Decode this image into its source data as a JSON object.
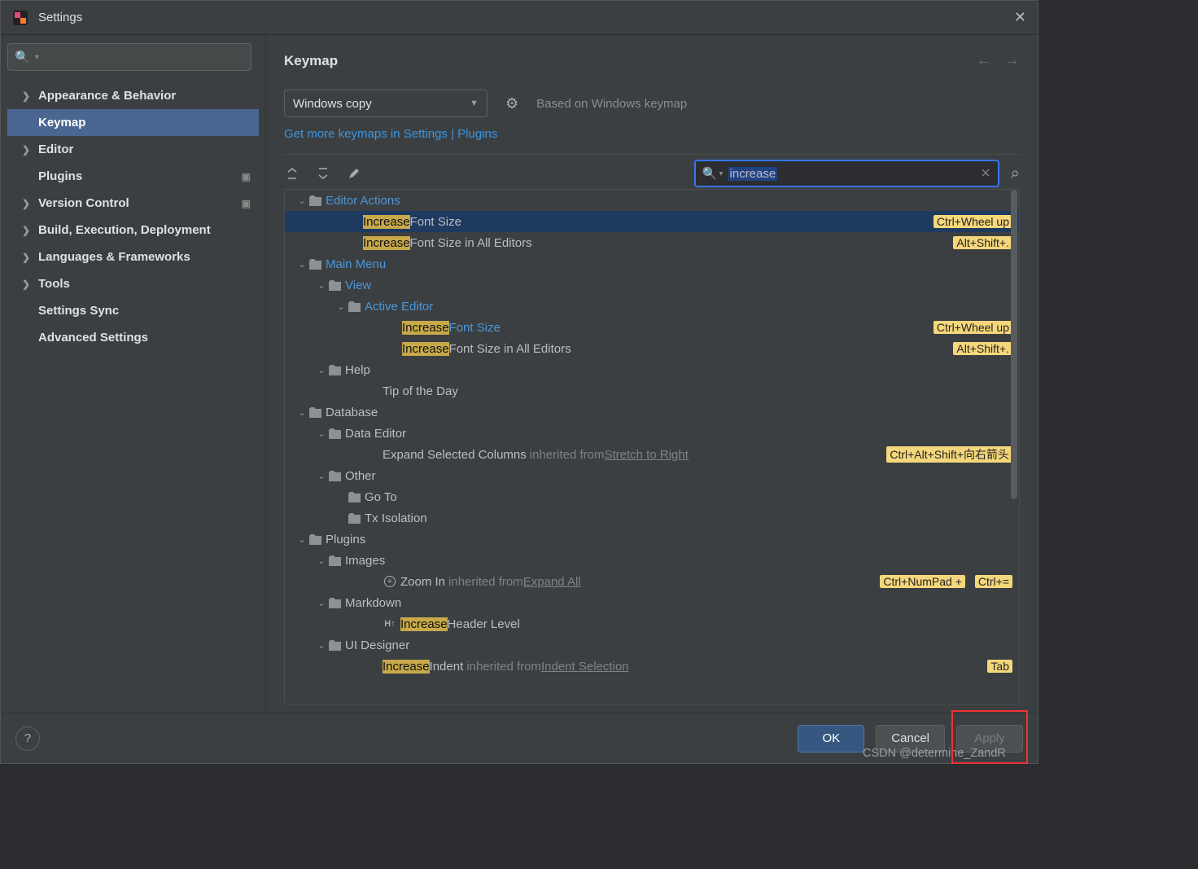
{
  "titlebar": {
    "title": "Settings"
  },
  "sidebar": {
    "search_placeholder": "",
    "items": [
      {
        "label": "Appearance & Behavior",
        "expandable": true
      },
      {
        "label": "Keymap",
        "expandable": false,
        "selected": true
      },
      {
        "label": "Editor",
        "expandable": true
      },
      {
        "label": "Plugins",
        "expandable": false,
        "trailing_icon": "project-level"
      },
      {
        "label": "Version Control",
        "expandable": true,
        "trailing_icon": "project-level"
      },
      {
        "label": "Build, Execution, Deployment",
        "expandable": true
      },
      {
        "label": "Languages & Frameworks",
        "expandable": true
      },
      {
        "label": "Tools",
        "expandable": true
      },
      {
        "label": "Settings Sync",
        "expandable": false
      },
      {
        "label": "Advanced Settings",
        "expandable": false
      }
    ]
  },
  "main": {
    "breadcrumb": "Keymap",
    "keymap_select": "Windows copy",
    "based_on": "Based on Windows keymap",
    "link": "Get more keymaps in Settings | Plugins",
    "toolbar_icons": [
      "expand-all",
      "collapse-all",
      "edit"
    ],
    "search_value": "increase",
    "tree": [
      {
        "d": 0,
        "kind": "group",
        "label": "Editor Actions",
        "link": true,
        "icon": "editor"
      },
      {
        "d": 1,
        "kind": "action",
        "hl": "Increase",
        "rest": " Font Size",
        "sc": [
          "Ctrl+Wheel up"
        ],
        "selected": true
      },
      {
        "d": 1,
        "kind": "action",
        "hl": "Increase",
        "rest": " Font Size in All Editors",
        "sc": [
          "Alt+Shift+."
        ]
      },
      {
        "d": 0,
        "kind": "group",
        "label": "Main Menu",
        "link": true,
        "icon": "menu"
      },
      {
        "d": 1,
        "kind": "group",
        "label": "View",
        "link": true,
        "icon": "folder"
      },
      {
        "d": 2,
        "kind": "group",
        "label": "Active Editor",
        "link": true,
        "icon": "folder"
      },
      {
        "d": 3,
        "kind": "action",
        "hl": "Increase",
        "rest_link": " Font Size",
        "sc": [
          "Ctrl+Wheel up"
        ]
      },
      {
        "d": 3,
        "kind": "action",
        "hl": "Increase",
        "rest": " Font Size in All Editors",
        "sc": [
          "Alt+Shift+."
        ]
      },
      {
        "d": 1,
        "kind": "group",
        "label": "Help",
        "icon": "folder"
      },
      {
        "d": 2,
        "kind": "action",
        "rest": "Tip of the Day"
      },
      {
        "d": 0,
        "kind": "group",
        "label": "Database",
        "icon": "folder"
      },
      {
        "d": 1,
        "kind": "group",
        "label": "Data Editor",
        "icon": "folder"
      },
      {
        "d": 2,
        "kind": "action",
        "rest": "Expand Selected Columns",
        "inh": "inherited from",
        "inh_link": "Stretch to Right",
        "sc": [
          "Ctrl+Alt+Shift+向右箭头"
        ]
      },
      {
        "d": 1,
        "kind": "group",
        "label": "Other",
        "icon": "other"
      },
      {
        "d": 2,
        "kind": "group",
        "label": "Go To",
        "icon": "folder",
        "noarrow": true
      },
      {
        "d": 2,
        "kind": "group",
        "label": "Tx Isolation",
        "icon": "folder",
        "noarrow": true
      },
      {
        "d": 0,
        "kind": "group",
        "label": "Plugins",
        "icon": "folder"
      },
      {
        "d": 1,
        "kind": "group",
        "label": "Images",
        "icon": "folder"
      },
      {
        "d": 2,
        "kind": "action",
        "icon": "plus",
        "rest": "Zoom In",
        "inh": "inherited from",
        "inh_link": "Expand All",
        "sc": [
          "Ctrl+NumPad +",
          "Ctrl+="
        ]
      },
      {
        "d": 1,
        "kind": "group",
        "label": "Markdown",
        "icon": "folder"
      },
      {
        "d": 2,
        "kind": "action",
        "icon": "header",
        "hl": "Increase",
        "rest": " Header Level"
      },
      {
        "d": 1,
        "kind": "group",
        "label": "UI Designer",
        "icon": "folder"
      },
      {
        "d": 2,
        "kind": "action",
        "hl": "Increase",
        "rest": " Indent",
        "inh": "inherited from",
        "inh_link": "Indent Selection",
        "sc": [
          "Tab"
        ]
      }
    ]
  },
  "footer": {
    "ok": "OK",
    "cancel": "Cancel",
    "apply": "Apply"
  },
  "watermark": "CSDN @determine_ZandR"
}
